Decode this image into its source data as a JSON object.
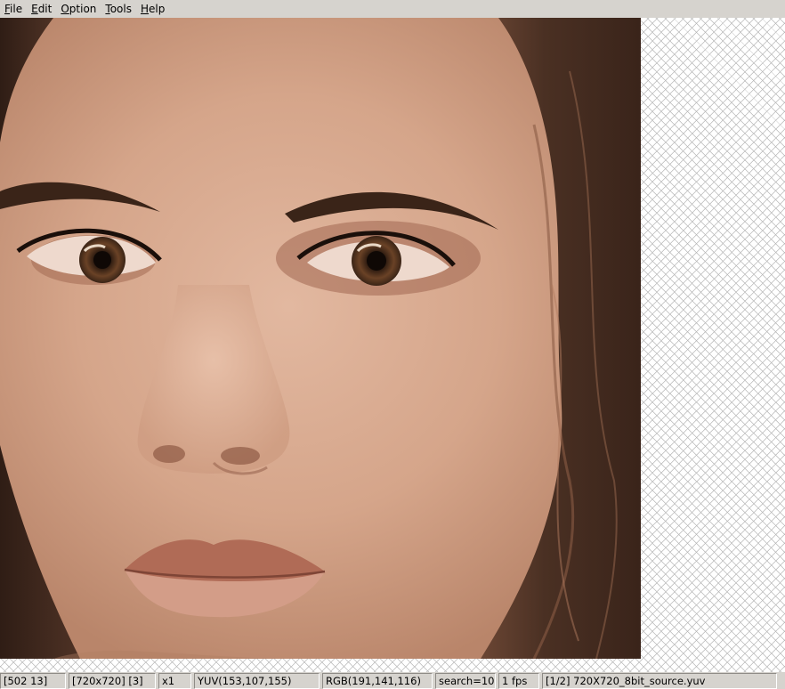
{
  "menubar": {
    "items": [
      {
        "label": "File",
        "mnemonic": "F",
        "rest": "ile"
      },
      {
        "label": "Edit",
        "mnemonic": "E",
        "rest": "dit"
      },
      {
        "label": "Option",
        "mnemonic": "O",
        "rest": "ption"
      },
      {
        "label": "Tools",
        "mnemonic": "T",
        "rest": "ools"
      },
      {
        "label": "Help",
        "mnemonic": "H",
        "rest": "elp"
      }
    ]
  },
  "viewer": {
    "frame_content": "close-up portrait photo of a woman's face"
  },
  "statusbar": {
    "position": "[502 13]",
    "resolution": "[720x720] [3]",
    "zoom": "x1",
    "yuv": "YUV(153,107,155)",
    "rgb": "RGB(191,141,116)",
    "search": "search=10",
    "fps": "1 fps",
    "file": "[1/2] 720X720_8bit_source.yuv"
  },
  "colors": {
    "chrome": "#d6d3ce",
    "skin": "#c79679",
    "hair": "#4a3023"
  }
}
